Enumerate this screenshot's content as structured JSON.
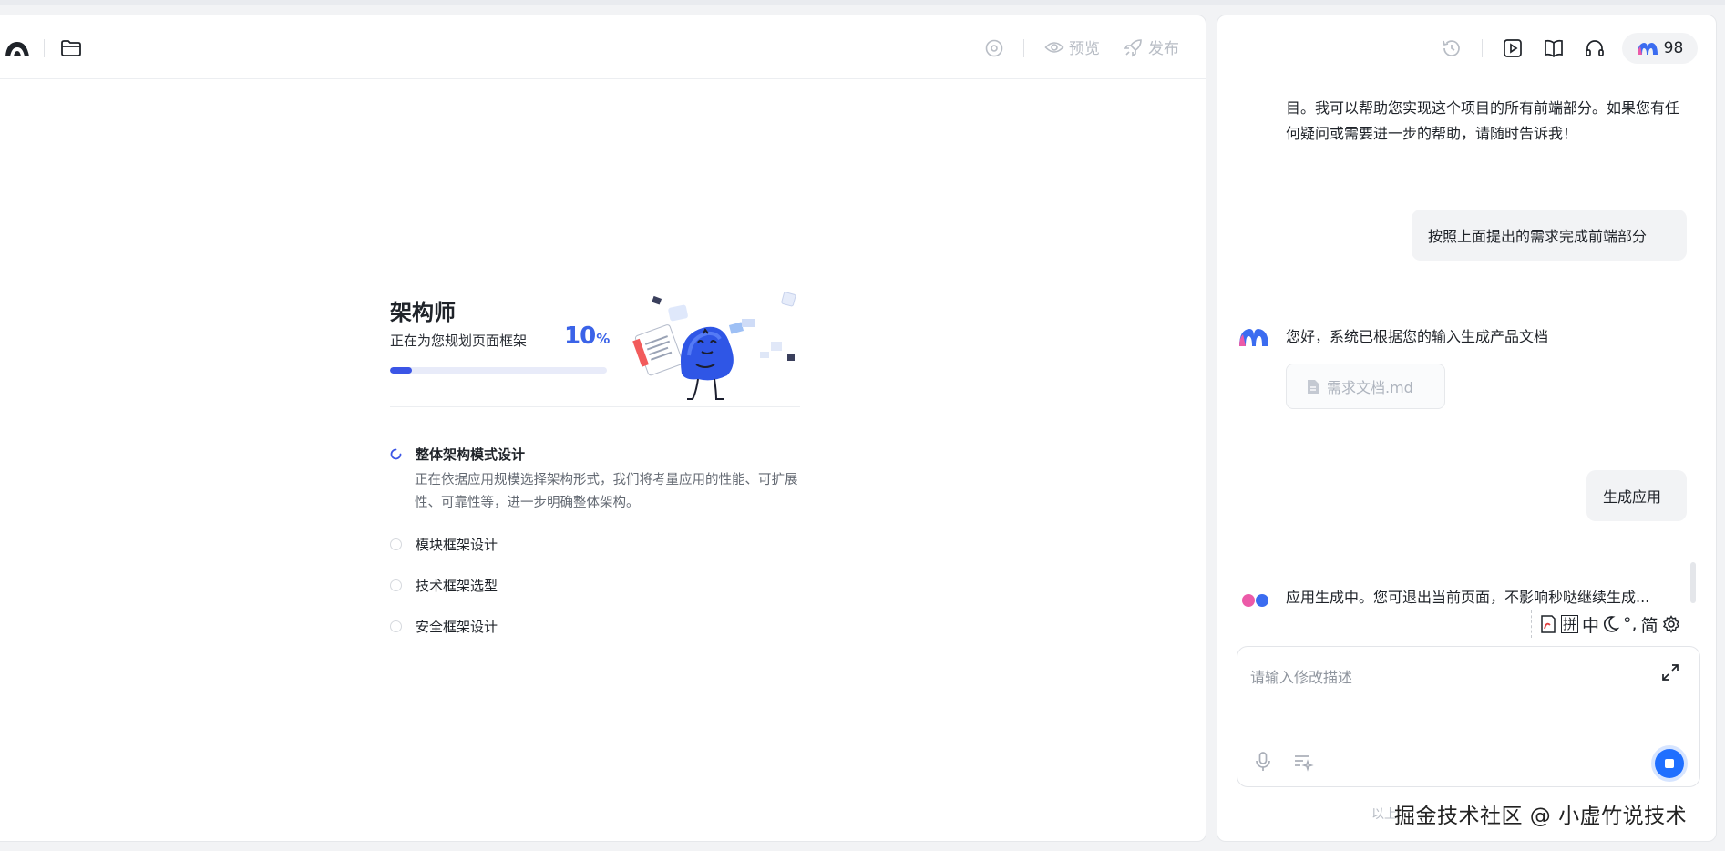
{
  "left": {
    "header": {
      "preview_label": "预览",
      "publish_label": "发布"
    },
    "architect": {
      "title": "架构师",
      "subtitle": "正在为您规划页面框架",
      "progress_value": "10",
      "progress_unit": "%",
      "progress_fraction": 0.1,
      "steps": [
        {
          "label": "整体架构模式设计",
          "status": "in-progress",
          "description": "正在依据应用规模选择架构形式，我们将考量应用的性能、可扩展性、可靠性等，进一步明确整体架构。"
        },
        {
          "label": "模块框架设计",
          "status": "pending"
        },
        {
          "label": "技术框架选型",
          "status": "pending"
        },
        {
          "label": "安全框架设计",
          "status": "pending"
        }
      ]
    }
  },
  "right": {
    "credits": "98",
    "messages": {
      "assistant_intro": "目。我可以帮助您实现这个项目的所有前端部分。如果您有任何疑问或需要进一步的帮助，请随时告诉我！",
      "user_1": "按照上面提出的需求完成前端部分",
      "assistant_doc": "您好，系统已根据您的输入生成产品文档",
      "doc_file": "需求文档.md",
      "user_2": "生成应用",
      "assistant_gen": "应用生成中。您可退出当前页面，不影响秒哒继续生成..."
    },
    "input": {
      "placeholder": "请输入修改描述"
    },
    "footnote": "以上"
  },
  "ime_toolbar": [
    "拼",
    "中",
    "°,",
    "简"
  ],
  "watermark": "掘金技术社区 @ 小虚竹说技术",
  "colors": {
    "accent": "#3b55e6",
    "send_button": "#1f6fff"
  }
}
